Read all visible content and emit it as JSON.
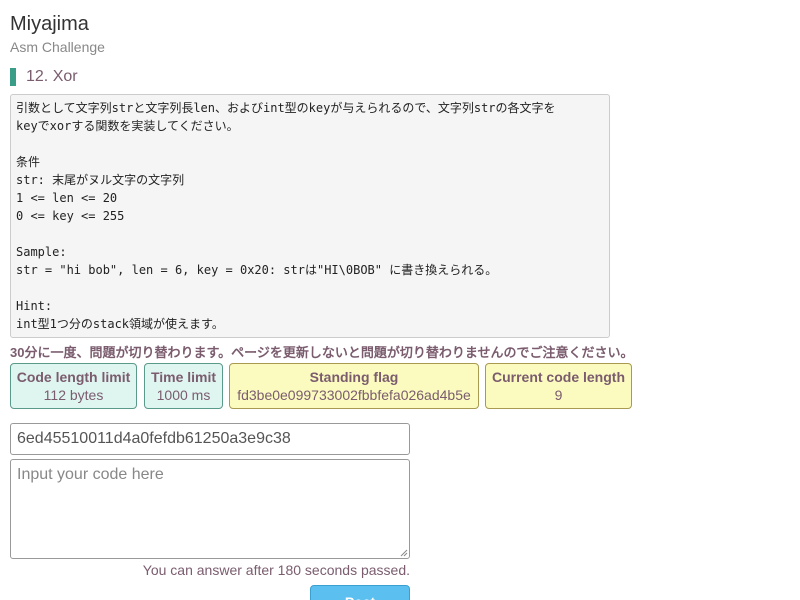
{
  "header": {
    "title": "Miyajima",
    "subtitle": "Asm Challenge"
  },
  "problem": {
    "heading": "12. Xor",
    "lines": [
      "引数として文字列strと文字列長len、およびint型のkeyが与えられるので、文字列strの各文字を",
      "keyでxorする関数を実装してください。",
      "",
      "条件",
      "str: 末尾がヌル文字の文字列",
      "1 <= len <= 20",
      "0 <= key <= 255",
      "",
      "Sample:",
      "str = \"hi bob\", len = 6, key = 0x20: strは\"HI\\0BOB\" に書き換えられる。",
      "",
      "Hint:",
      "int型1つ分のstack領域が使えます。"
    ]
  },
  "warning": "30分に一度、問題が切り替わります。ページを更新しないと問題が切り替わりませんのでご注意ください。",
  "stats": {
    "code_length_limit": {
      "label": "Code length limit",
      "value": "112 bytes"
    },
    "time_limit": {
      "label": "Time limit",
      "value": "1000 ms"
    },
    "standing_flag": {
      "label": "Standing flag",
      "value": "fd3be0e099733002fbbfefa026ad4b5e"
    },
    "current_code_length": {
      "label": "Current code length",
      "value": "9"
    }
  },
  "form": {
    "hash_value": "6ed45510011d4a0fefdb61250a3e9c38",
    "code_placeholder": "Input your code here",
    "answer_note": "You can answer after 180 seconds passed.",
    "post_label": "Post"
  }
}
